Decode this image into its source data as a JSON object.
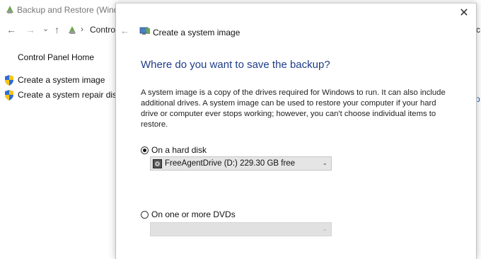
{
  "background": {
    "title": "Backup and Restore (Windows",
    "address": "Control",
    "address_right": "c",
    "right_link": "p",
    "sidebar": {
      "home": "Control Panel Home",
      "tasks": [
        "Create a system image",
        "Create a system repair disc"
      ]
    }
  },
  "dialog": {
    "title": "Create a system image",
    "heading": "Where do you want to save the backup?",
    "description": "A system image is a copy of the drives required for Windows to run. It can also include additional drives. A system image can be used to restore your computer if your hard drive or computer ever stops working; however, you can't choose individual items to restore.",
    "options": {
      "hard_disk": {
        "label": "On a hard disk",
        "selected": true,
        "drive": "FreeAgentDrive (D:)  229.30 GB free"
      },
      "dvd": {
        "label": "On one or more DVDs",
        "selected": false,
        "value": ""
      }
    },
    "close": "✕"
  },
  "icons": {
    "back": "←",
    "forward": "→",
    "recent": "⌄",
    "up": "↑",
    "separator": "›",
    "chevron": "⌄"
  }
}
